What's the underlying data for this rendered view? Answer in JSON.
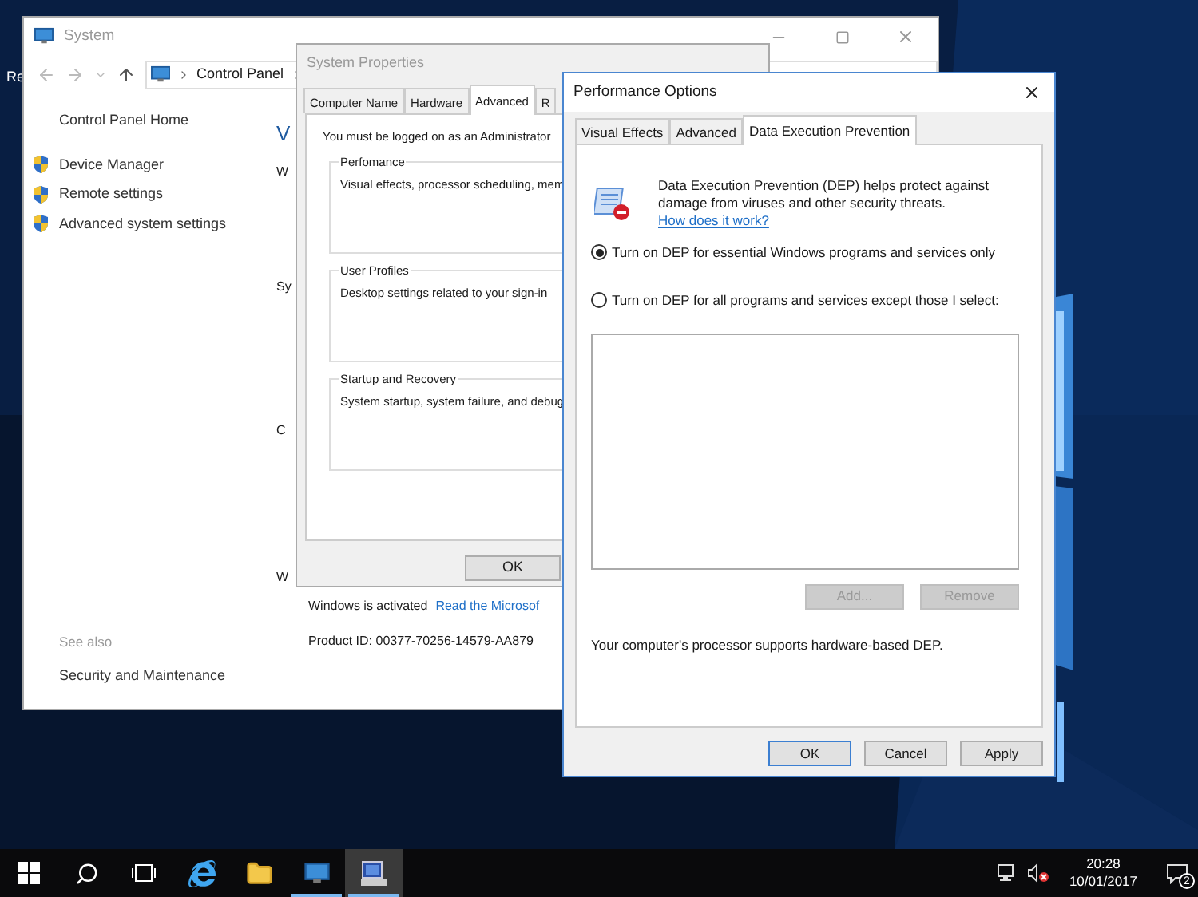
{
  "desktop": {
    "icon_label": "Re"
  },
  "system_window": {
    "title": "System",
    "breadcrumb": [
      "Control Panel"
    ],
    "home_link": "Control Panel Home",
    "tasks": [
      "Device Manager",
      "Remote settings",
      "Advanced system settings"
    ],
    "see_also_heading": "See also",
    "see_also_links": [
      "Security and Maintenance"
    ],
    "main_heading": "V",
    "main_labels": [
      "W",
      "Sy",
      "C",
      "W"
    ],
    "activation_status": "Windows is activated",
    "activation_link": "Read the Microsof",
    "product_id": "Product ID: 00377-70256-14579-AA879"
  },
  "system_properties": {
    "title": "System Properties",
    "tabs": [
      {
        "label": "Computer Name",
        "selected": false
      },
      {
        "label": "Hardware",
        "selected": false
      },
      {
        "label": "Advanced",
        "selected": true
      },
      {
        "label": "R",
        "selected": false
      }
    ],
    "note": "You must be logged on as an Administrator",
    "groups": [
      {
        "title": "Perfomance",
        "description": "Visual effects, processor scheduling, mem"
      },
      {
        "title": "User Profiles",
        "description": "Desktop settings related to your sign-in"
      },
      {
        "title": "Startup and Recovery",
        "description": "System startup, system failure, and debug"
      }
    ],
    "buttons": [
      "OK"
    ]
  },
  "performance_options": {
    "title": "Performance Options",
    "tabs": [
      {
        "label": "Visual Effects",
        "selected": false
      },
      {
        "label": "Advanced",
        "selected": false
      },
      {
        "label": "Data Execution Prevention",
        "selected": true
      }
    ],
    "description": "Data Execution Prevention (DEP) helps protect against damage from viruses and other security threats.",
    "link": "How does it work?",
    "options": [
      {
        "label": "Turn on DEP for essential Windows programs and services only",
        "selected": true
      },
      {
        "label": "Turn on DEP for all programs and services except those I select:",
        "selected": false
      }
    ],
    "list_buttons": [
      {
        "label": "Add...",
        "disabled": true
      },
      {
        "label": "Remove",
        "disabled": true
      }
    ],
    "status": "Your computer's processor supports hardware-based DEP.",
    "buttons": [
      {
        "label": "OK",
        "default": true
      },
      {
        "label": "Cancel",
        "default": false
      },
      {
        "label": "Apply",
        "default": false
      }
    ]
  },
  "taskbar": {
    "apps": [
      {
        "kind": "start"
      },
      {
        "kind": "search"
      },
      {
        "kind": "task-view"
      },
      {
        "kind": "browser",
        "running": false,
        "active": false
      },
      {
        "kind": "folder",
        "running": false,
        "active": false
      },
      {
        "kind": "control-panel",
        "running": true,
        "active": false
      },
      {
        "kind": "system",
        "running": true,
        "active": true
      }
    ],
    "volume": {
      "muted": true
    },
    "clock": {
      "time": "20:28",
      "date": "10/01/2017"
    },
    "notification_count": "2"
  }
}
